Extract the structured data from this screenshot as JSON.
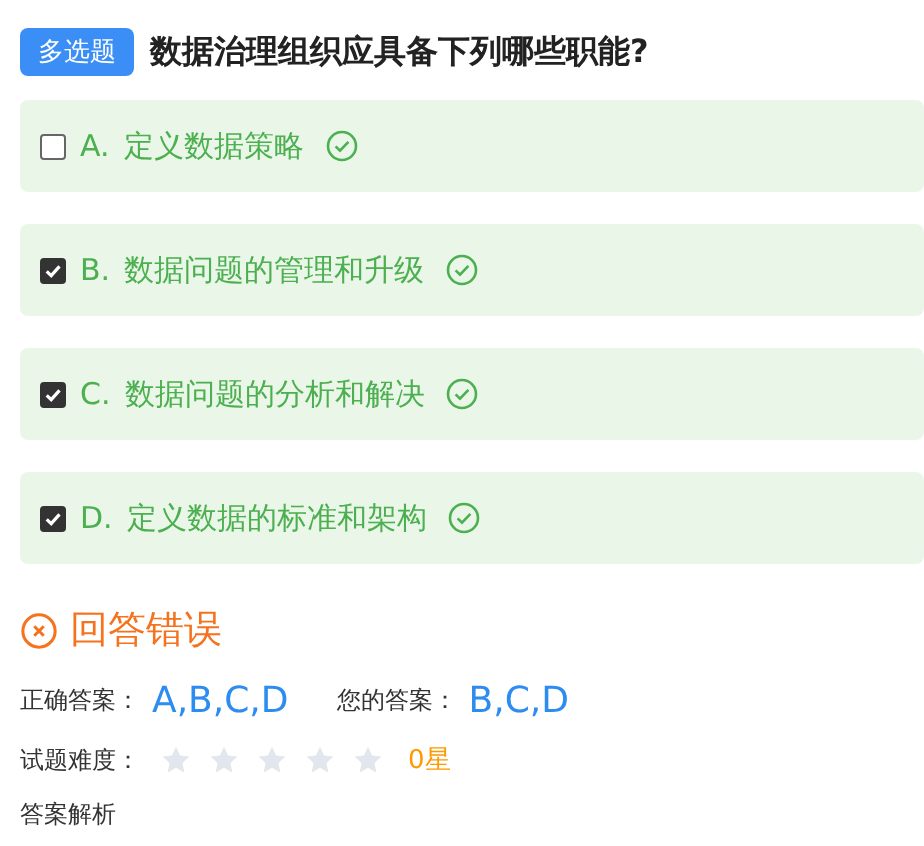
{
  "question": {
    "badge": "多选题",
    "title": "数据治理组织应具备下列哪些职能?"
  },
  "options": [
    {
      "letter": "A.",
      "text": "定义数据策略",
      "checked": false
    },
    {
      "letter": "B.",
      "text": "数据问题的管理和升级",
      "checked": true
    },
    {
      "letter": "C.",
      "text": "数据问题的分析和解决",
      "checked": true
    },
    {
      "letter": "D.",
      "text": "定义数据的标准和架构",
      "checked": true
    }
  ],
  "result": {
    "kind": "wrong",
    "text": "回答错误"
  },
  "answers": {
    "correct_label": "正确答案：",
    "correct_value": "A,B,C,D",
    "yours_label": "您的答案：",
    "yours_value": "B,C,D"
  },
  "difficulty": {
    "label": "试题难度：",
    "stars": 0,
    "reading": "0星"
  },
  "analysis": {
    "label": "答案解析"
  }
}
